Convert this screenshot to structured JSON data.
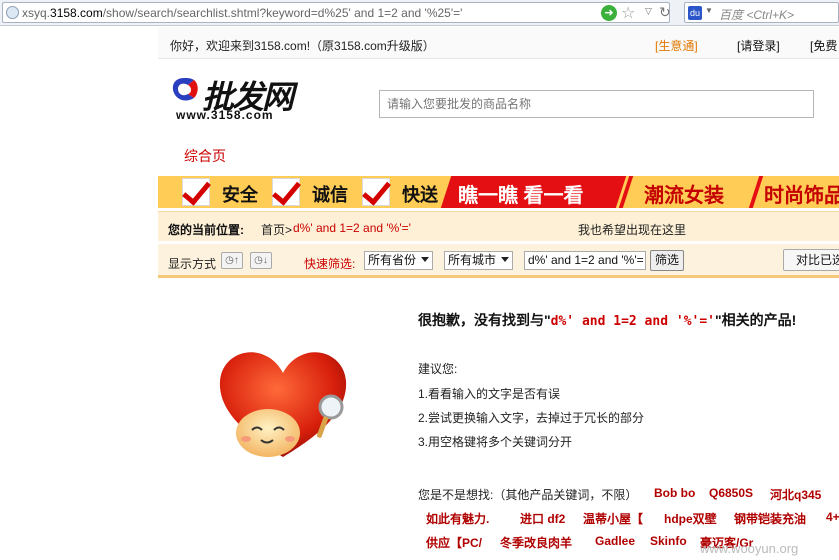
{
  "browser": {
    "url_prefix": "xsyq.",
    "url_host": "3158.com",
    "url_rest": "/show/search/searchlist.shtml?keyword=d%25' and 1=2 and '%25'='",
    "search_engine_placeholder": "百度 <Ctrl+K>"
  },
  "topbar": {
    "welcome": "你好，欢迎来到3158.com!（原3158.com升级版）",
    "link_business": "[生意通]",
    "link_login": "[请登录]",
    "link_free": "[免费"
  },
  "logo": {
    "cn": "批发网",
    "url": "www.3158.com"
  },
  "search": {
    "placeholder": "请输入您要批发的商品名称"
  },
  "nav": {
    "tab": "综合页"
  },
  "banner": {
    "trust1": "安全",
    "trust2": "诚信",
    "trust3": "快送",
    "promo1": "瞧一瞧  看一看",
    "promo2": "潮流女装",
    "promo3": "时尚饰品"
  },
  "breadcrumb": {
    "title": "您的当前位置:",
    "home": "首页>",
    "current": "d%' and 1=2 and '%'='",
    "message": "我也希望出现在这里"
  },
  "filter": {
    "display_label": "显示方式",
    "quick_label": "快速筛选:",
    "province": "所有省份",
    "city": "所有城市",
    "keyword": "d%' and 1=2 and '%'=",
    "filter_button": "筛选",
    "compare_button": "对比已选"
  },
  "result": {
    "sorry_prefix": "很抱歉，没有找到与\"",
    "sorry_keyword": "d%' and 1=2 and '%'='",
    "sorry_suffix": "\"相关的产品!",
    "suggest_title": "建议您:",
    "suggestions": [
      "1.看看输入的文字是否有误",
      "2.尝试更换输入文字，去掉过于冗长的部分",
      "3.用空格键将多个关键词分开"
    ],
    "related_label": "您是不是想找:（其他产品关键词，不限）",
    "related_row1": [
      "Bob bo",
      "Q6850S",
      "河北q345"
    ],
    "related_row2": [
      "如此有魅力.",
      "进口 df2",
      "温蒂小屋【",
      "hdpe双壁",
      "钢带铠装充油",
      "4+"
    ],
    "related_row3": [
      "供应【PC/",
      "冬季改良肉羊",
      "Gadlee",
      "Skinfo",
      "豪迈客/Gr"
    ]
  },
  "watermark": "www.wooyun.org",
  "colors": {
    "accent_red": "#c00000",
    "banner_yellow": "#ffcc55",
    "promo_red": "#e40f12",
    "crumb_bg": "#fdf0d6"
  }
}
